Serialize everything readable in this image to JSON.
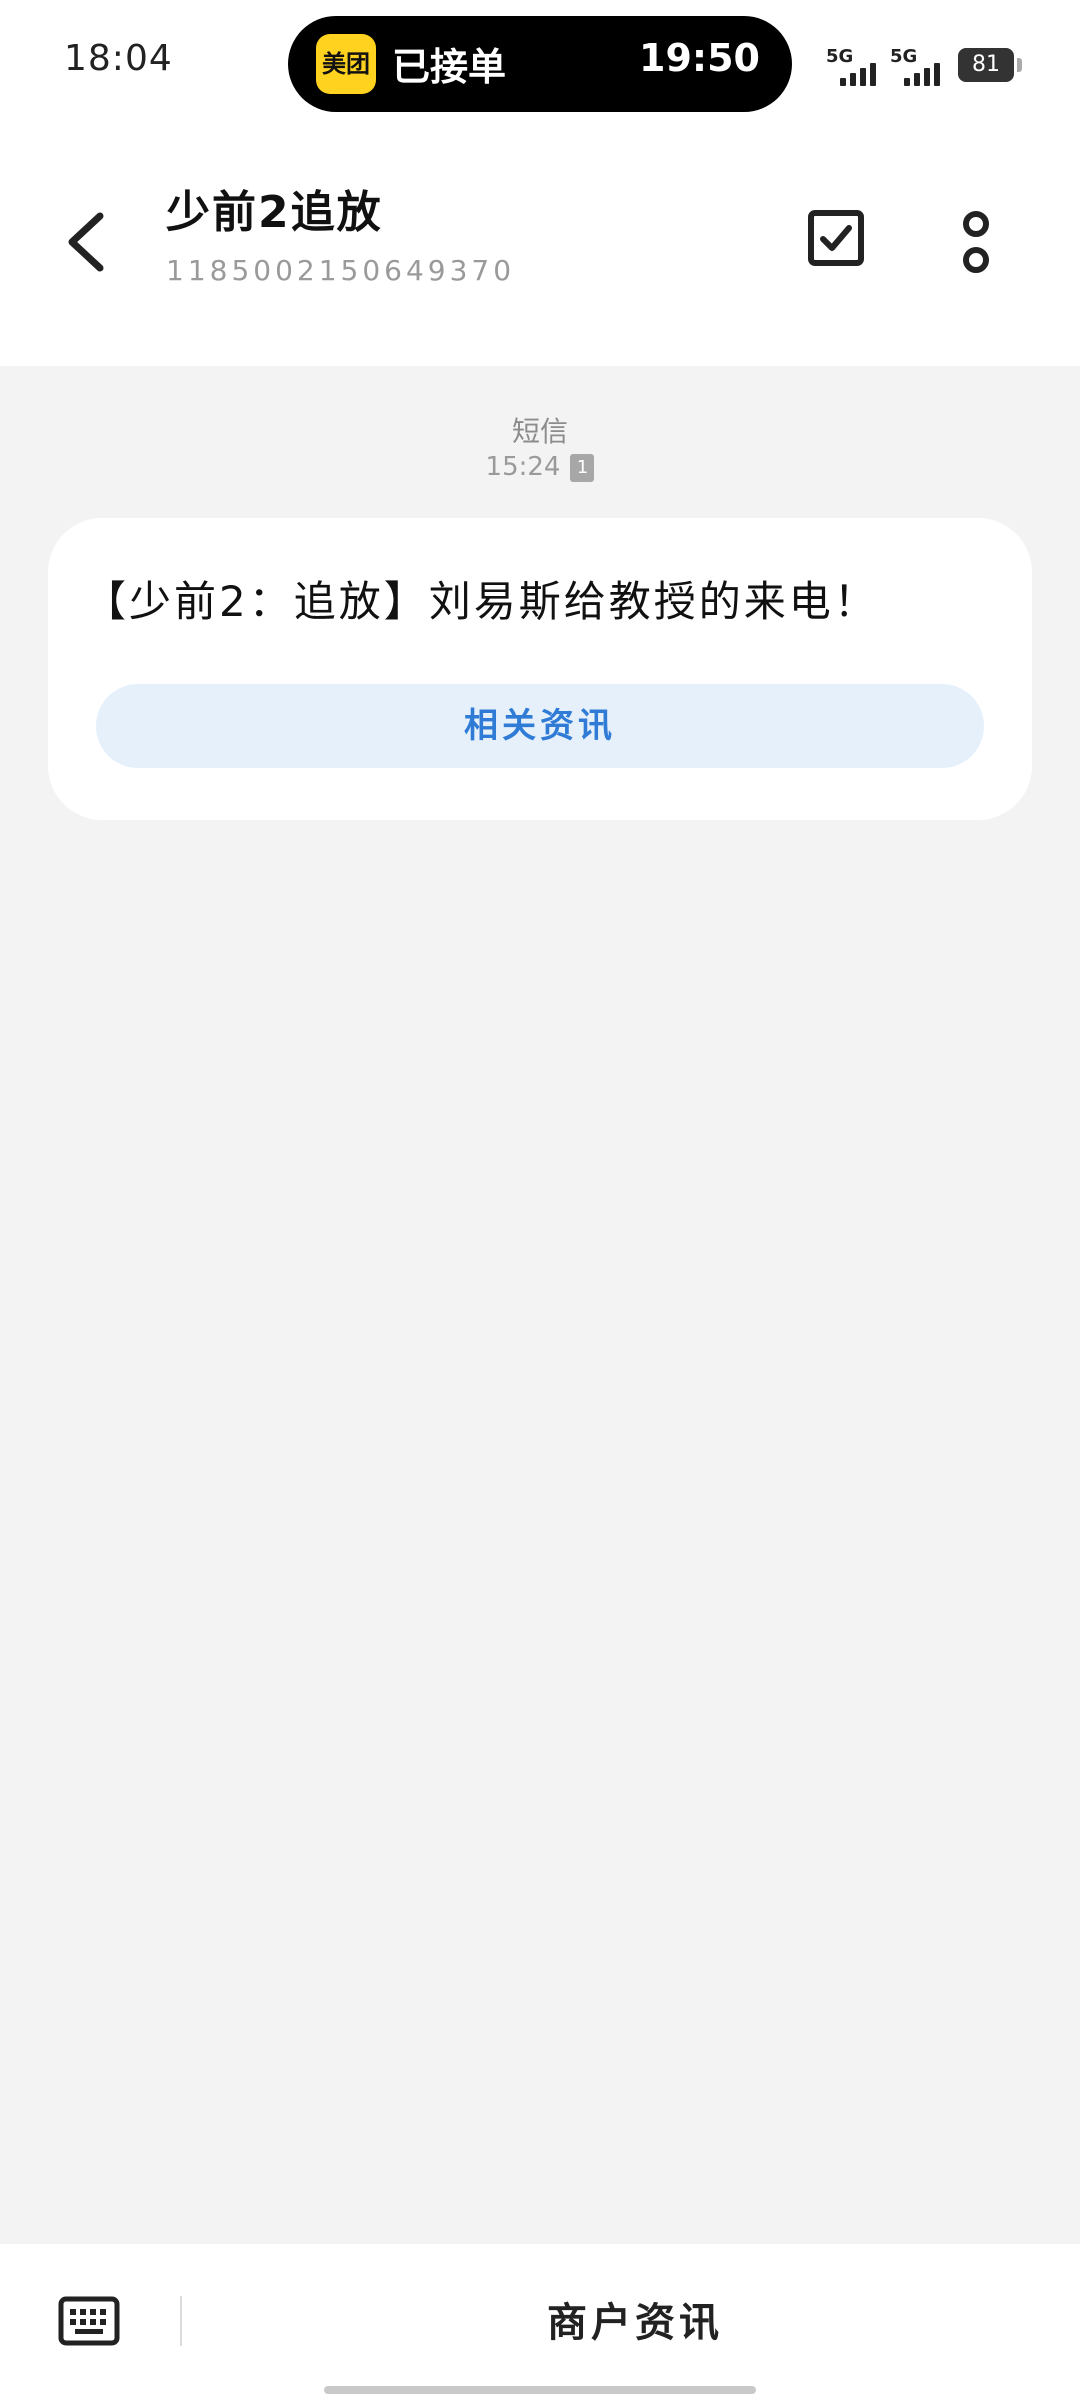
{
  "status_bar": {
    "time": "18:04",
    "island_logo": "美团",
    "island_text": "已接单",
    "island_time": "19:50",
    "signal1_label": "5G",
    "signal2_label": "5G",
    "battery": "81"
  },
  "header": {
    "contact_name": "少前2追放",
    "contact_number": "1185002150649370",
    "icons": [
      "back-icon",
      "select-checkbox-icon",
      "more-icon"
    ]
  },
  "conversation": {
    "type_label": "短信",
    "time": "15:24",
    "sim_badge": "1",
    "message_text": "【少前2：追放】刘易斯给教授的来电！",
    "related_button": "相关资讯"
  },
  "bottom_bar": {
    "keyboard_icon": "keyboard-icon",
    "merchant_button": "商户资讯"
  }
}
